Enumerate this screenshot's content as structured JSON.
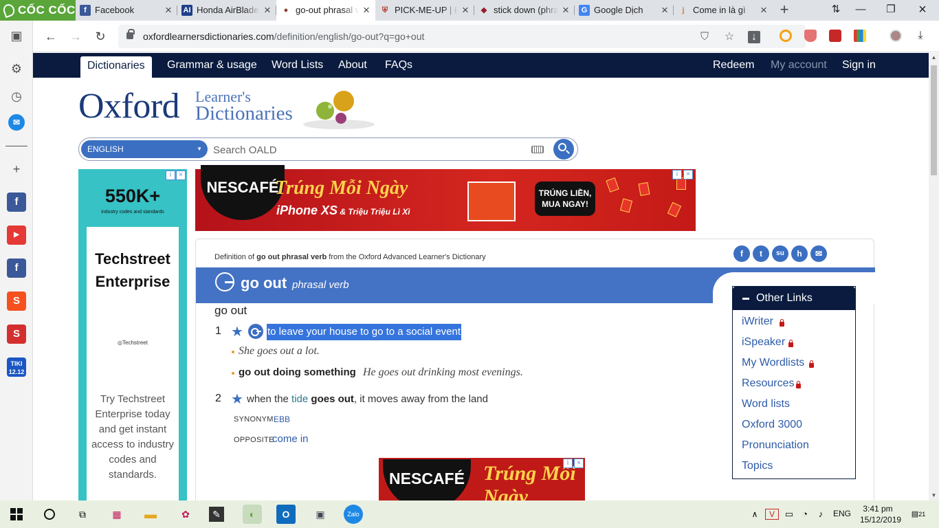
{
  "browser": {
    "logo": "CỐC CỐC",
    "tabs": [
      {
        "title": "Facebook",
        "fav": "f",
        "color": "#3b5998"
      },
      {
        "title": "Honda AirBlade",
        "fav": "AI",
        "color": "#1e3f8a"
      },
      {
        "title": "go-out phrasal verb",
        "fav": "●",
        "color": "#8a3e2e"
      },
      {
        "title": "PICK-ME-UP | Định nghĩa",
        "fav": "⛨",
        "color": "#b5352c"
      },
      {
        "title": "stick down (phrasal verb)",
        "fav": "◆",
        "color": "#9c1d2b"
      },
      {
        "title": "Google Dịch",
        "fav": "G",
        "color": "#4285f4"
      },
      {
        "title": "Come in là gì",
        "fav": "j",
        "color": "#e8761c"
      }
    ],
    "new_tab": "+",
    "url_host": "oxfordlearnersdictionaries.com",
    "url_path": "/definition/english/go-out?q=go+out"
  },
  "site_nav": {
    "items": [
      "Dictionaries",
      "Grammar & usage",
      "Word Lists",
      "About",
      "FAQs"
    ],
    "right": [
      "Redeem",
      "My account",
      "Sign in"
    ]
  },
  "logo": {
    "oxford": "Oxford",
    "learners": "Learner's",
    "dictionaries": "Dictionaries"
  },
  "search": {
    "language": "ENGLISH",
    "placeholder": "Search OALD"
  },
  "ad_left": {
    "big": "550K+",
    "small": "industry codes and standards",
    "title": "Techstreet Enterprise",
    "brand": "◎Techstreet",
    "body": "Try Techstreet Enterprise today and get instant access to industry codes and standards."
  },
  "ad_top": {
    "brand": "NESCAFÉ",
    "headline": "Trúng Mỗi Ngày",
    "sub_main": "iPhone XS",
    "sub_rest": " & Triệu Triệu Lì Xì",
    "pill": "TRÚNG LIỀN, MUA NGAY!"
  },
  "entry": {
    "definition_of_prefix": "Definition of ",
    "definition_of_word": "go out phrasal verb",
    "definition_of_suffix": " from the Oxford Advanced Learner's Dictionary",
    "headword": "go out",
    "pos": "phrasal verb",
    "headword_line": "go out",
    "senses": [
      {
        "num": "1",
        "definition": "to leave your house to go to a social event",
        "example1": "She goes out a lot.",
        "collocation": "go out doing something",
        "example2": "He goes out drinking most evenings."
      },
      {
        "num": "2",
        "def_a": "when the ",
        "def_link": "tide",
        "def_b": " ",
        "def_bold": "goes out",
        "def_c": ", it moves away from the land",
        "synonym_label": "SYNONYM",
        "synonym": "EBB",
        "opposite_label": "OPPOSITE",
        "opposite": "come in"
      }
    ],
    "share_icons": [
      "f",
      "t",
      "su",
      "h",
      "✉"
    ]
  },
  "ad_inline": {
    "brand": "NESCAFÉ",
    "text": "Trúng Mỗi Ngày"
  },
  "other_links": {
    "title": "Other Links",
    "items": [
      {
        "label": "iWriter",
        "locked": true
      },
      {
        "label": "iSpeaker",
        "locked": true
      },
      {
        "label": "My Wordlists",
        "locked": true
      },
      {
        "label": "Resources",
        "locked": true
      },
      {
        "label": "Word lists",
        "locked": false
      },
      {
        "label": "Oxford 3000",
        "locked": false
      },
      {
        "label": "Pronunciation",
        "locked": false
      },
      {
        "label": "Topics",
        "locked": false
      }
    ]
  },
  "taskbar": {
    "lang": "ENG",
    "time": "3:41 pm",
    "date": "15/12/2019",
    "notif": "21"
  },
  "colors": {
    "nav_bg": "#0a1b3f",
    "accent": "#3b6fc2",
    "head_bar": "#4472c4",
    "highlight": "#3574dc"
  }
}
